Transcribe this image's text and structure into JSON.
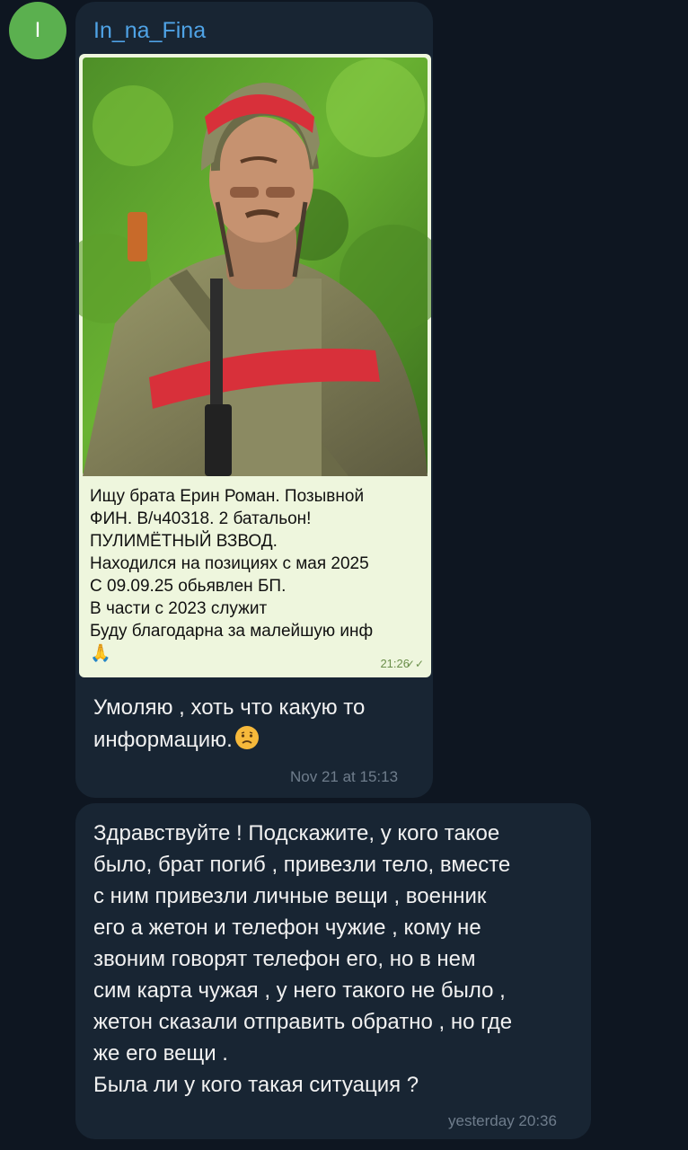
{
  "sender": {
    "avatar_letter": "I",
    "name": "In_na_Fina"
  },
  "photo_message": {
    "caption": "Ищу брата Ерин Роман. Позывной\nФИН. В/ч40318. 2 батальон!\nПУЛИМЁТНЫЙ ВЗВОД.\nНаходился на позициях с мая 2025\nС 09.09.25 обьявлен БП.\nВ части с 2023 служит\nБуду благодарна за малейшую инф",
    "caption_emoji": "🙏",
    "time": "21:26",
    "status_icon": "double-check-icon"
  },
  "text_message": {
    "text": "Умоляю , хоть что какую то\nинформацию.",
    "emoji": "sad-face-emoji",
    "time": "Nov 21 at 15:13"
  },
  "reply_message": {
    "text": "Здравствуйте ! Подскажите, у кого такое\nбыло, брат погиб , привезли тело, вместе\nс ним привезли личные вещи , военник\nего а жетон и телефон чужие , кому не\nзвоним говорят телефон его, но в нем\nсим карта чужая , у него такого не было ,\nжетон сказали отправить обратно , но где\nже его вещи .\nБыла ли у кого такая ситуация ?",
    "time": "yesterday 20:36"
  },
  "colors": {
    "background": "#0e1621",
    "bubble": "#182533",
    "sender_name": "#4fa3e6",
    "avatar": "#5bb04f"
  }
}
